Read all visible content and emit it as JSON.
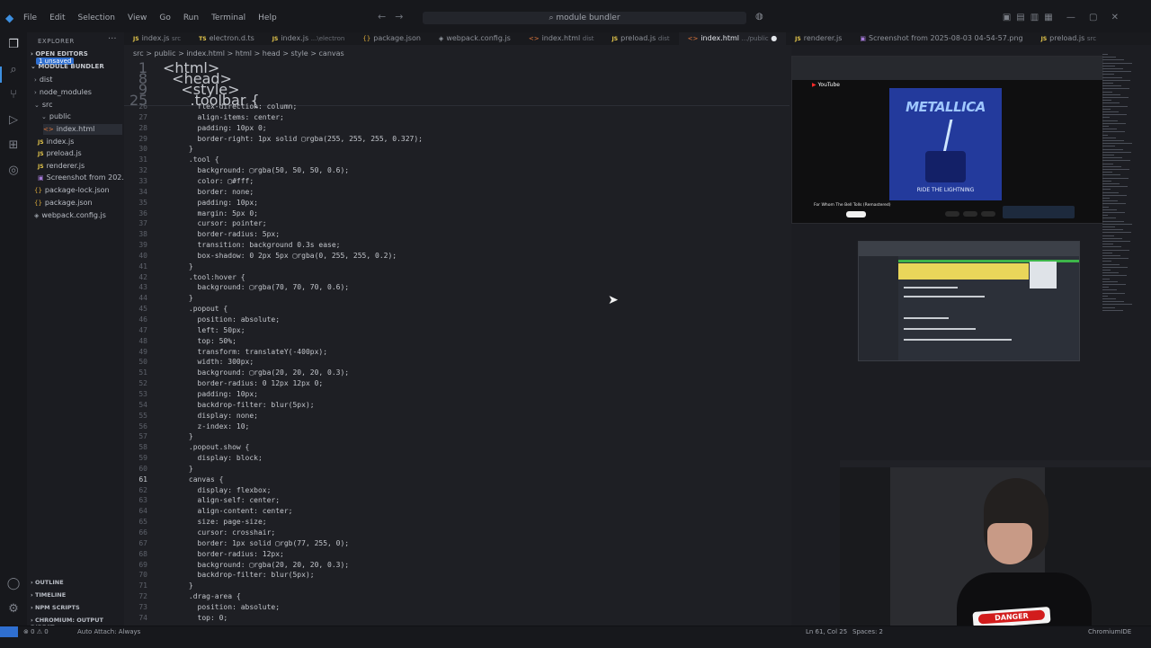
{
  "titlebar": {
    "menu": [
      "File",
      "Edit",
      "Selection",
      "View",
      "Go",
      "Run",
      "Terminal",
      "Help"
    ],
    "search": "module bundler"
  },
  "explorer": {
    "title": "EXPLORER",
    "open_editors": "OPEN EDITORS",
    "unsaved_badge": "1 unsaved",
    "project": "MODULE BUNDLER",
    "tree": [
      {
        "label": "dist",
        "kind": "folder"
      },
      {
        "label": "node_modules",
        "kind": "folder"
      },
      {
        "label": "src",
        "kind": "folder"
      },
      {
        "label": "public",
        "kind": "folder"
      },
      {
        "label": "index.html",
        "kind": "html"
      },
      {
        "label": "index.js",
        "kind": "js"
      },
      {
        "label": "preload.js",
        "kind": "js"
      },
      {
        "label": "renderer.js",
        "kind": "js"
      },
      {
        "label": "Screenshot from 202...",
        "kind": "img"
      },
      {
        "label": "package-lock.json",
        "kind": "json"
      },
      {
        "label": "package.json",
        "kind": "json"
      },
      {
        "label": "webpack.config.js",
        "kind": "js"
      }
    ],
    "bottom": [
      "OUTLINE",
      "TIMELINE",
      "NPM SCRIPTS",
      "CHROMIUM: OUTPUT DIRECT..."
    ]
  },
  "tabs": [
    {
      "label": "index.js",
      "hint": "src"
    },
    {
      "label": "electron.d.ts",
      "hint": ""
    },
    {
      "label": "index.js",
      "hint": "...\\electron"
    },
    {
      "label": "package.json",
      "hint": ""
    },
    {
      "label": "webpack.config.js",
      "hint": ""
    },
    {
      "label": "index.html",
      "hint": "dist"
    },
    {
      "label": "preload.js",
      "hint": "dist"
    },
    {
      "label": "index.html",
      "hint": ".../public"
    },
    {
      "label": "renderer.js",
      "hint": ""
    },
    {
      "label": "Screenshot from 2025-08-03 04-54-57.png",
      "hint": ""
    },
    {
      "label": "preload.js",
      "hint": "src"
    }
  ],
  "breadcrumbs": "src > public > index.html > html > head > style > canvas",
  "sticky": [
    {
      "n": "1",
      "code": "<html>"
    },
    {
      "n": "8",
      "code": "  <head>"
    },
    {
      "n": "9",
      "code": "    <style>"
    },
    {
      "n": "25",
      "code": "      .toolbar {"
    }
  ],
  "code": [
    {
      "n": "26",
      "code": "        flex-direction: column;"
    },
    {
      "n": "27",
      "code": "        align-items: center;"
    },
    {
      "n": "28",
      "code": "        padding: 10px 0;"
    },
    {
      "n": "29",
      "code": "        border-right: 1px solid ▢rgba(255, 255, 255, 0.327);"
    },
    {
      "n": "30",
      "code": "      }"
    },
    {
      "n": "31",
      "code": "      .tool {"
    },
    {
      "n": "32",
      "code": "        background: ▢rgba(50, 50, 50, 0.6);"
    },
    {
      "n": "33",
      "code": "        color: ▢#fff;"
    },
    {
      "n": "34",
      "code": "        border: none;"
    },
    {
      "n": "35",
      "code": "        padding: 10px;"
    },
    {
      "n": "36",
      "code": "        margin: 5px 0;"
    },
    {
      "n": "37",
      "code": "        cursor: pointer;"
    },
    {
      "n": "38",
      "code": "        border-radius: 5px;"
    },
    {
      "n": "39",
      "code": "        transition: background 0.3s ease;"
    },
    {
      "n": "40",
      "code": "        box-shadow: 0 2px 5px ▢rgba(0, 255, 255, 0.2);"
    },
    {
      "n": "41",
      "code": "      }"
    },
    {
      "n": "42",
      "code": "      .tool:hover {"
    },
    {
      "n": "43",
      "code": "        background: ▢rgba(70, 70, 70, 0.6);"
    },
    {
      "n": "44",
      "code": "      }"
    },
    {
      "n": "45",
      "code": "      .popout {"
    },
    {
      "n": "46",
      "code": "        position: absolute;"
    },
    {
      "n": "47",
      "code": "        left: 50px;"
    },
    {
      "n": "48",
      "code": "        top: 50%;"
    },
    {
      "n": "49",
      "code": "        transform: translateY(-400px);"
    },
    {
      "n": "50",
      "code": "        width: 300px;"
    },
    {
      "n": "51",
      "code": "        background: ▢rgba(20, 20, 20, 0.3);"
    },
    {
      "n": "52",
      "code": "        border-radius: 0 12px 12px 0;"
    },
    {
      "n": "53",
      "code": "        padding: 10px;"
    },
    {
      "n": "54",
      "code": "        backdrop-filter: blur(5px);"
    },
    {
      "n": "55",
      "code": "        display: none;"
    },
    {
      "n": "56",
      "code": "        z-index: 10;"
    },
    {
      "n": "57",
      "code": "      }"
    },
    {
      "n": "58",
      "code": "      .popout.show {"
    },
    {
      "n": "59",
      "code": "        display: block;"
    },
    {
      "n": "60",
      "code": "      }"
    },
    {
      "n": "61",
      "code": "      canvas {"
    },
    {
      "n": "62",
      "code": "        display: flexbox;"
    },
    {
      "n": "63",
      "code": "        align-self: center;"
    },
    {
      "n": "64",
      "code": "        align-content: center;"
    },
    {
      "n": "65",
      "code": "        size: page-size;"
    },
    {
      "n": "66",
      "code": "        cursor: crosshair;"
    },
    {
      "n": "67",
      "code": "        border: 1px solid ▢rgb(77, 255, 0);"
    },
    {
      "n": "68",
      "code": "        border-radius: 12px;"
    },
    {
      "n": "69",
      "code": "        background: ▢rgba(20, 20, 20, 0.3);"
    },
    {
      "n": "70",
      "code": "        backdrop-filter: blur(5px);"
    },
    {
      "n": "71",
      "code": "      }"
    },
    {
      "n": "72",
      "code": "      .drag-area {"
    },
    {
      "n": "73",
      "code": "        position: absolute;"
    },
    {
      "n": "74",
      "code": "        top: 0;"
    }
  ],
  "current_line": "61",
  "youtube": {
    "logo": "YouTube",
    "album_band": "METALLICA",
    "album_title": "RIDE THE LIGHTNING",
    "video_title": "For Whom The Bell Tolls (Remastered)"
  },
  "webcam": {
    "shirt_text": "DANGER"
  },
  "status": {
    "problems": "⊗ 0 ⚠ 0",
    "attach": "Auto Attach: Always",
    "position": "Ln 61, Col 25",
    "spaces": "Spaces: 2",
    "app": "ChromiumIDE"
  }
}
